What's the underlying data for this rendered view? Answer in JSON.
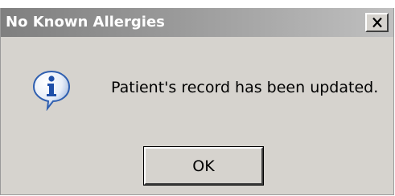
{
  "dialog": {
    "title": "No Known Allergies",
    "close_label": "×",
    "message": "Patient's record has been updated.",
    "ok_label": "OK",
    "icon": "information-icon"
  },
  "colors": {
    "title_text": "#ffffff",
    "dialog_bg": "#d6d3ce",
    "icon_blue": "#2f5fb0"
  }
}
